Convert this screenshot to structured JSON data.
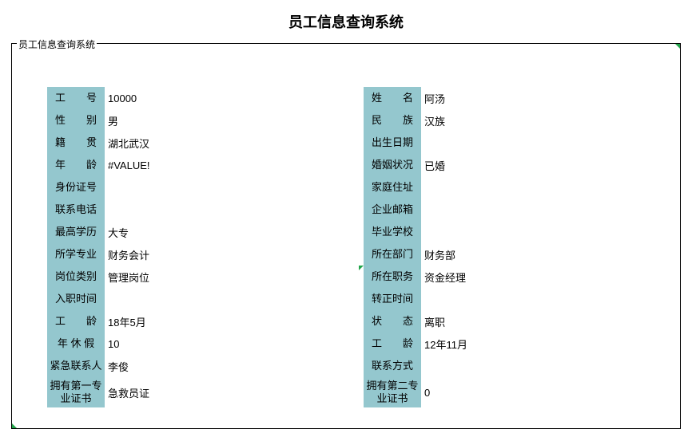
{
  "page_title": "员工信息查询系统",
  "fieldset_legend": "员工信息查询系统",
  "left_rows": [
    {
      "label": "工　　号",
      "value": "10000",
      "tall": false,
      "mark": false
    },
    {
      "label": "性　　别",
      "value": "男",
      "tall": false,
      "mark": false
    },
    {
      "label": "籍　　贯",
      "value": "湖北武汉",
      "tall": false,
      "mark": false
    },
    {
      "label": "年　　龄",
      "value": "#VALUE!",
      "tall": false,
      "mark": false
    },
    {
      "label": "身份证号",
      "value": "",
      "tall": false,
      "mark": false
    },
    {
      "label": "联系电话",
      "value": "",
      "tall": false,
      "mark": false
    },
    {
      "label": "最高学历",
      "value": "大专",
      "tall": false,
      "mark": false
    },
    {
      "label": "所学专业",
      "value": "财务会计",
      "tall": false,
      "mark": false
    },
    {
      "label": "岗位类别",
      "value": "管理岗位",
      "tall": false,
      "mark": false
    },
    {
      "label": "入职时间",
      "value": "",
      "tall": false,
      "mark": false
    },
    {
      "label": "工　　龄",
      "value": "18年5月",
      "tall": false,
      "mark": false
    },
    {
      "label": "年 休 假",
      "value": "10",
      "tall": false,
      "mark": false
    },
    {
      "label": "紧急联系人",
      "value": "李俊",
      "tall": false,
      "mark": false
    },
    {
      "label": "拥有第一专业证书",
      "value": "急救员证",
      "tall": true,
      "mark": false
    }
  ],
  "right_rows": [
    {
      "label": "姓　　名",
      "value": "阿汤",
      "tall": false,
      "mark": false
    },
    {
      "label": "民　　族",
      "value": "汉族",
      "tall": false,
      "mark": false
    },
    {
      "label": "出生日期",
      "value": "",
      "tall": false,
      "mark": false
    },
    {
      "label": "婚姻状况",
      "value": "已婚",
      "tall": false,
      "mark": false
    },
    {
      "label": "家庭住址",
      "value": "",
      "tall": false,
      "mark": false
    },
    {
      "label": "企业邮箱",
      "value": "",
      "tall": false,
      "mark": false
    },
    {
      "label": "毕业学校",
      "value": "",
      "tall": false,
      "mark": false
    },
    {
      "label": "所在部门",
      "value": "财务部",
      "tall": false,
      "mark": false
    },
    {
      "label": "所在职务",
      "value": "资金经理",
      "tall": false,
      "mark": true
    },
    {
      "label": "转正时间",
      "value": "",
      "tall": false,
      "mark": false
    },
    {
      "label": "状　　态",
      "value": "离职",
      "tall": false,
      "mark": false
    },
    {
      "label": "工　　龄",
      "value": "12年11月",
      "tall": false,
      "mark": false
    },
    {
      "label": "联系方式",
      "value": "",
      "tall": false,
      "mark": false
    },
    {
      "label": "拥有第二专业证书",
      "value": "0",
      "tall": true,
      "mark": false
    }
  ]
}
